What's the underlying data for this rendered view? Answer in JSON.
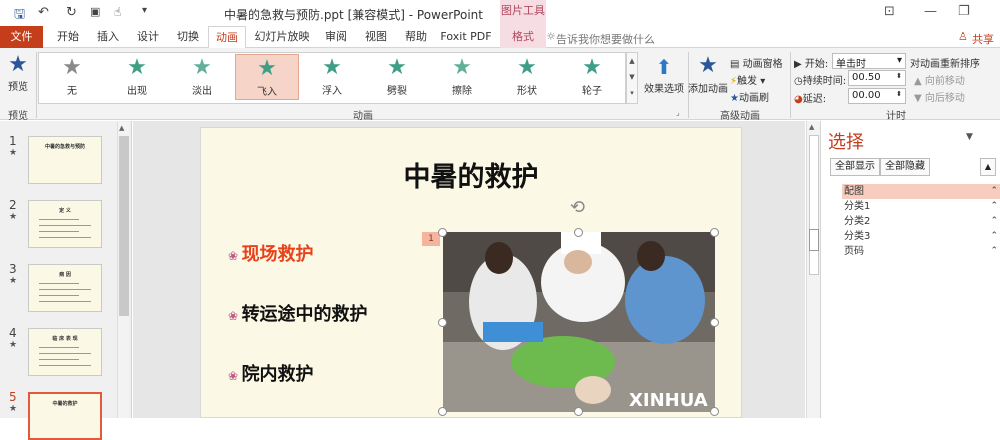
{
  "titlebar": {
    "doc_title": "中暑的急救与预防.ppt [兼容模式] - PowerPoint",
    "tool_header": "图片工具"
  },
  "tabs": [
    "文件",
    "开始",
    "插入",
    "设计",
    "切换",
    "动画",
    "幻灯片放映",
    "审阅",
    "视图",
    "帮助",
    "Foxit PDF",
    "格式"
  ],
  "tell_me": "告诉我你想要做什么",
  "share": "共享",
  "ribbon": {
    "preview_label": "预览",
    "preview_group": "预览",
    "animation_group": "动画",
    "advanced_group": "高级动画",
    "timing_group": "计时",
    "effects": [
      {
        "label": "无",
        "color": "#8a8a8a"
      },
      {
        "label": "出现",
        "color": "#3f9e86"
      },
      {
        "label": "淡出",
        "color": "#62b09a"
      },
      {
        "label": "飞入",
        "color": "#3f9e86"
      },
      {
        "label": "浮入",
        "color": "#3f9e86"
      },
      {
        "label": "劈裂",
        "color": "#3f9e86"
      },
      {
        "label": "擦除",
        "color": "#62b09a"
      },
      {
        "label": "形状",
        "color": "#3f9e86"
      },
      {
        "label": "轮子",
        "color": "#3f9e86"
      }
    ],
    "effect_options": "效果选项",
    "add_animation": "添加动画",
    "anim_pane": "动画窗格",
    "trigger": "触发",
    "anim_painter": "动画刷",
    "start_label": "开始:",
    "start_value": "单击时",
    "duration_label": "持续时间:",
    "duration_value": "00.50",
    "delay_label": "延迟:",
    "delay_value": "00.00",
    "reorder_title": "对动画重新排序",
    "move_earlier": "向前移动",
    "move_later": "向后移动"
  },
  "thumbs": [
    {
      "num": "1",
      "title": "中暑的急救与预防"
    },
    {
      "num": "2",
      "title": "定 义"
    },
    {
      "num": "3",
      "title": "病 因"
    },
    {
      "num": "4",
      "title": "临 床 表 现"
    },
    {
      "num": "5",
      "title": "中暑的救护"
    }
  ],
  "slide": {
    "title": "中暑的救护",
    "bullets": [
      {
        "text": "现场救护",
        "color": "#e8421c"
      },
      {
        "text": "转运途中的救护",
        "color": "#111111"
      },
      {
        "text": "院内救护",
        "color": "#111111"
      }
    ],
    "anim_tag": "1",
    "photo_watermark": "XINHUA"
  },
  "selection_pane": {
    "title": "选择",
    "show_all": "全部显示",
    "hide_all": "全部隐藏",
    "items": [
      "配图",
      "分类1",
      "分类2",
      "分类3",
      "页码"
    ]
  }
}
